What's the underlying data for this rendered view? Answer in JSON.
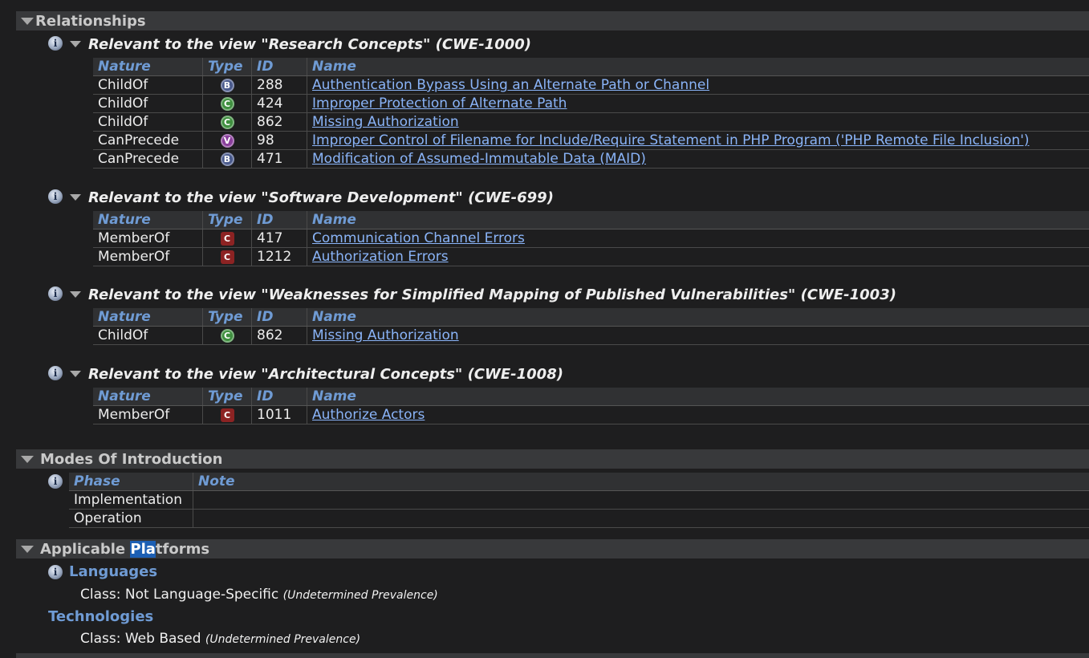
{
  "relationships": {
    "title": "Relationships",
    "views": [
      {
        "title": "Relevant to the view \"Research Concepts\" (CWE-1000)",
        "headers": {
          "nature": "Nature",
          "type": "Type",
          "id": "ID",
          "name": "Name"
        },
        "rows": [
          {
            "nature": "ChildOf",
            "type": "B",
            "id": "288",
            "name": "Authentication Bypass Using an Alternate Path or Channel"
          },
          {
            "nature": "ChildOf",
            "type": "C",
            "id": "424",
            "name": "Improper Protection of Alternate Path"
          },
          {
            "nature": "ChildOf",
            "type": "C",
            "id": "862",
            "name": "Missing Authorization"
          },
          {
            "nature": "CanPrecede",
            "type": "V",
            "id": "98",
            "name": "Improper Control of Filename for Include/Require Statement in PHP Program ('PHP Remote File Inclusion')"
          },
          {
            "nature": "CanPrecede",
            "type": "B",
            "id": "471",
            "name": "Modification of Assumed-Immutable Data (MAID)"
          }
        ]
      },
      {
        "title": "Relevant to the view \"Software Development\" (CWE-699)",
        "headers": {
          "nature": "Nature",
          "type": "Type",
          "id": "ID",
          "name": "Name"
        },
        "rows": [
          {
            "nature": "MemberOf",
            "type": "C",
            "id": "417",
            "name": "Communication Channel Errors"
          },
          {
            "nature": "MemberOf",
            "type": "C",
            "id": "1212",
            "name": "Authorization Errors"
          }
        ]
      },
      {
        "title": "Relevant to the view \"Weaknesses for Simplified Mapping of Published Vulnerabilities\" (CWE-1003)",
        "headers": {
          "nature": "Nature",
          "type": "Type",
          "id": "ID",
          "name": "Name"
        },
        "rows": [
          {
            "nature": "ChildOf",
            "type": "C",
            "id": "862",
            "name": "Missing Authorization"
          }
        ]
      },
      {
        "title": "Relevant to the view \"Architectural Concepts\" (CWE-1008)",
        "headers": {
          "nature": "Nature",
          "type": "Type",
          "id": "ID",
          "name": "Name"
        },
        "rows": [
          {
            "nature": "MemberOf",
            "type": "C",
            "id": "1011",
            "name": "Authorize Actors"
          }
        ]
      }
    ]
  },
  "modes": {
    "title": "Modes Of Introduction",
    "headers": {
      "phase": "Phase",
      "note": "Note"
    },
    "rows": [
      {
        "phase": "Implementation",
        "note": ""
      },
      {
        "phase": "Operation",
        "note": ""
      }
    ]
  },
  "platforms": {
    "title_pre": "Applicable ",
    "title_hl": "Pla",
    "title_post": "tforms",
    "languages_label": "Languages",
    "languages_class": "Class: Not Language-Specific",
    "languages_prev": "(Undetermined Prevalence)",
    "technologies_label": "Technologies",
    "technologies_class": "Class: Web Based",
    "technologies_prev": "(Undetermined Prevalence)"
  },
  "colors": {
    "badge_B": "#4a5a8c",
    "badge_C_green": "#3f8f3f",
    "badge_V": "#8a3f9c",
    "badge_C_cat": "#8c2323",
    "link": "#8ab4f8",
    "header_text": "#6f9bd4"
  },
  "icons": {
    "info": "info-icon",
    "collapse": "collapse-triangle-icon"
  }
}
